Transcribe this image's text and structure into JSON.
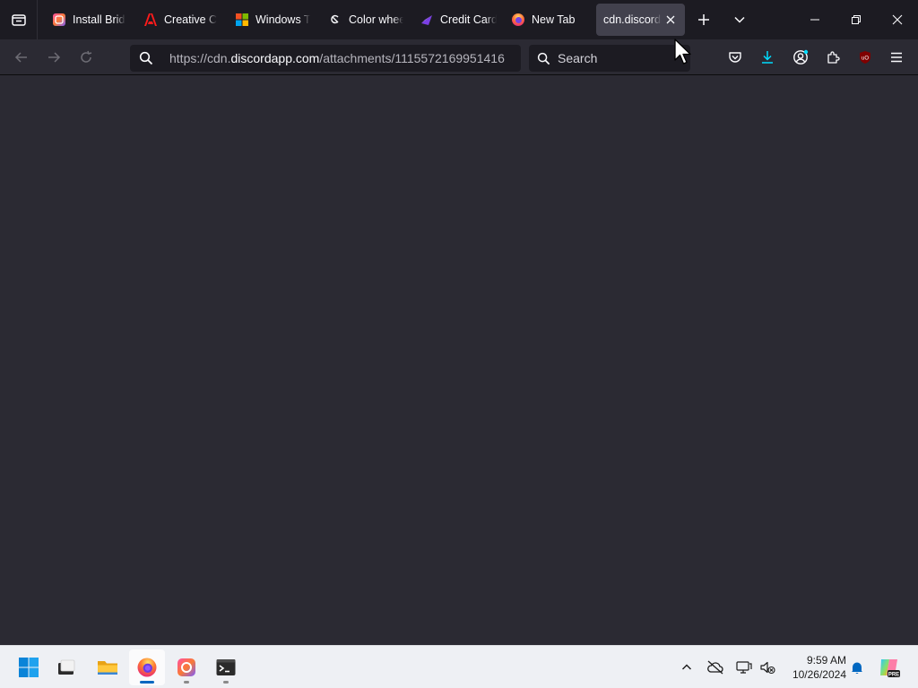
{
  "tabs": [
    {
      "title": "Install Bridge",
      "icon": "creative-cloud-icon"
    },
    {
      "title": "Creative Cloud",
      "icon": "adobe-icon"
    },
    {
      "title": "Windows Terminal",
      "icon": "microsoft-icon"
    },
    {
      "title": "Color wheel",
      "icon": "color-wheel-icon"
    },
    {
      "title": "Credit Card",
      "icon": "credit-card-site-icon"
    },
    {
      "title": "New Tab",
      "icon": "firefox-icon"
    },
    {
      "title": "cdn.discordapp.com",
      "icon": "none",
      "active": true
    }
  ],
  "urlbar": {
    "scheme": "https://cdn.",
    "host": "discordapp.com",
    "path": "/attachments/1115572169951416"
  },
  "search": {
    "placeholder": "Search"
  },
  "clock": {
    "time": "9:59 AM",
    "date": "10/26/2024"
  },
  "colors": {
    "tab_bg": "#1c1b22",
    "toolbar_bg": "#2b2a33",
    "active_tab": "#42414d",
    "accent_download": "#00ddff",
    "taskbar_bg": "#eef0f4",
    "notification": "#0067c0"
  },
  "taskbar_apps": [
    "windows-start-icon",
    "file-explorer-dark-icon",
    "folder-icon",
    "firefox-icon",
    "creative-cloud-icon",
    "terminal-icon"
  ],
  "tray_icons": [
    "chevron-up-icon",
    "onedrive-offline-icon",
    "display-icon",
    "speaker-muted-icon",
    "notification-bell-icon",
    "copilot-pre-icon"
  ]
}
